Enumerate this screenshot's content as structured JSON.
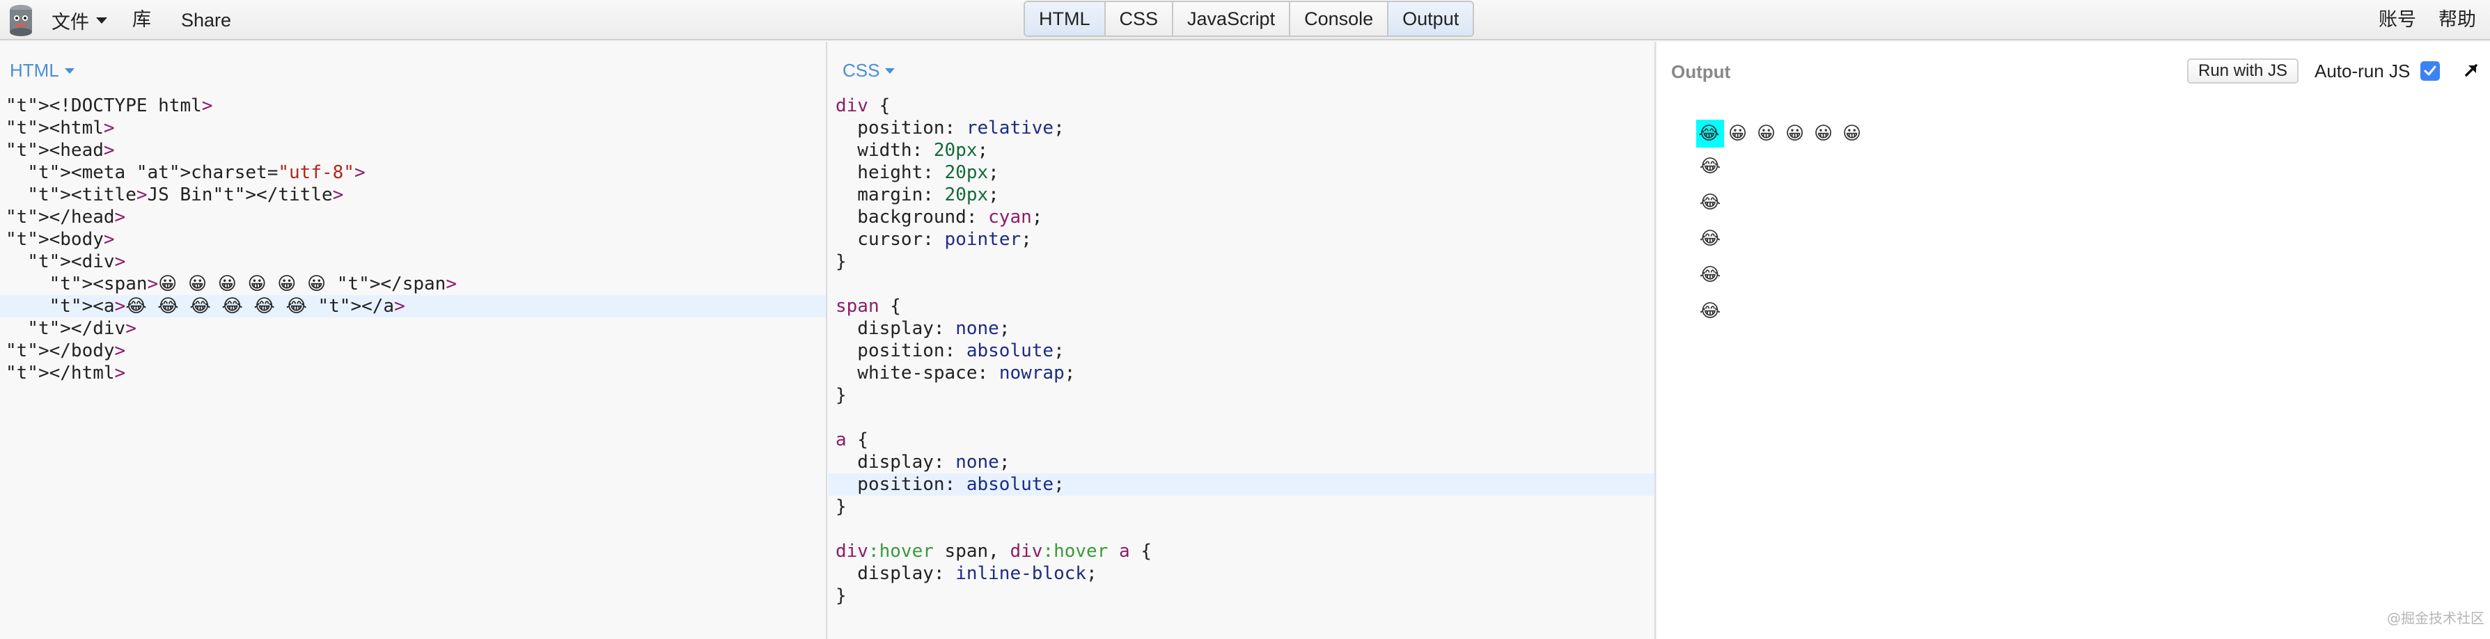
{
  "topbar": {
    "menu_files": "文件",
    "menu_library": "库",
    "menu_share": "Share",
    "tabs": [
      {
        "label": "HTML",
        "active": true
      },
      {
        "label": "CSS",
        "active": false
      },
      {
        "label": "JavaScript",
        "active": false
      },
      {
        "label": "Console",
        "active": false
      },
      {
        "label": "Output",
        "active": true
      }
    ],
    "account": "账号",
    "help": "帮助"
  },
  "html_panel": {
    "label": "HTML",
    "lines": [
      "<!DOCTYPE html>",
      "<html>",
      "<head>",
      "  <meta charset=\"utf-8\">",
      "  <title>JS Bin</title>",
      "</head>",
      "<body>",
      "  <div>",
      "    <span>😀 😀 😀 😀 😀 😀 </span>",
      "    <a>😂 😂 😂 😂 😂 😂 </a>",
      "  </div>",
      "</body>",
      "</html>"
    ],
    "highlighted_line": 9
  },
  "css_panel": {
    "label": "CSS",
    "lines": [
      "div {",
      "  position: relative;",
      "  width: 20px;",
      "  height: 20px;",
      "  margin: 20px;",
      "  background: cyan;",
      "  cursor: pointer;",
      "}",
      "",
      "span {",
      "  display: none;",
      "  position: absolute;",
      "  white-space: nowrap;",
      "}",
      "",
      "a {",
      "  display: none;",
      "  position: absolute;",
      "}",
      "",
      "div:hover span, div:hover a {",
      "  display: inline-block;",
      "}"
    ],
    "highlighted_line": 17
  },
  "output_panel": {
    "label": "Output",
    "run_button": "Run with JS",
    "autorun_label": "Auto-run JS",
    "autorun_checked": true,
    "row_emojis": [
      "😂",
      "😀",
      "😀",
      "😀",
      "😀",
      "😀"
    ],
    "column_emojis": [
      "😂",
      "😂",
      "😂",
      "😂",
      "😂"
    ],
    "watermark": "@掘金技术社区"
  },
  "colors": {
    "accent": "#4a8fd6",
    "hover_box": "#00ffff",
    "checkbox": "#3b82f6"
  }
}
